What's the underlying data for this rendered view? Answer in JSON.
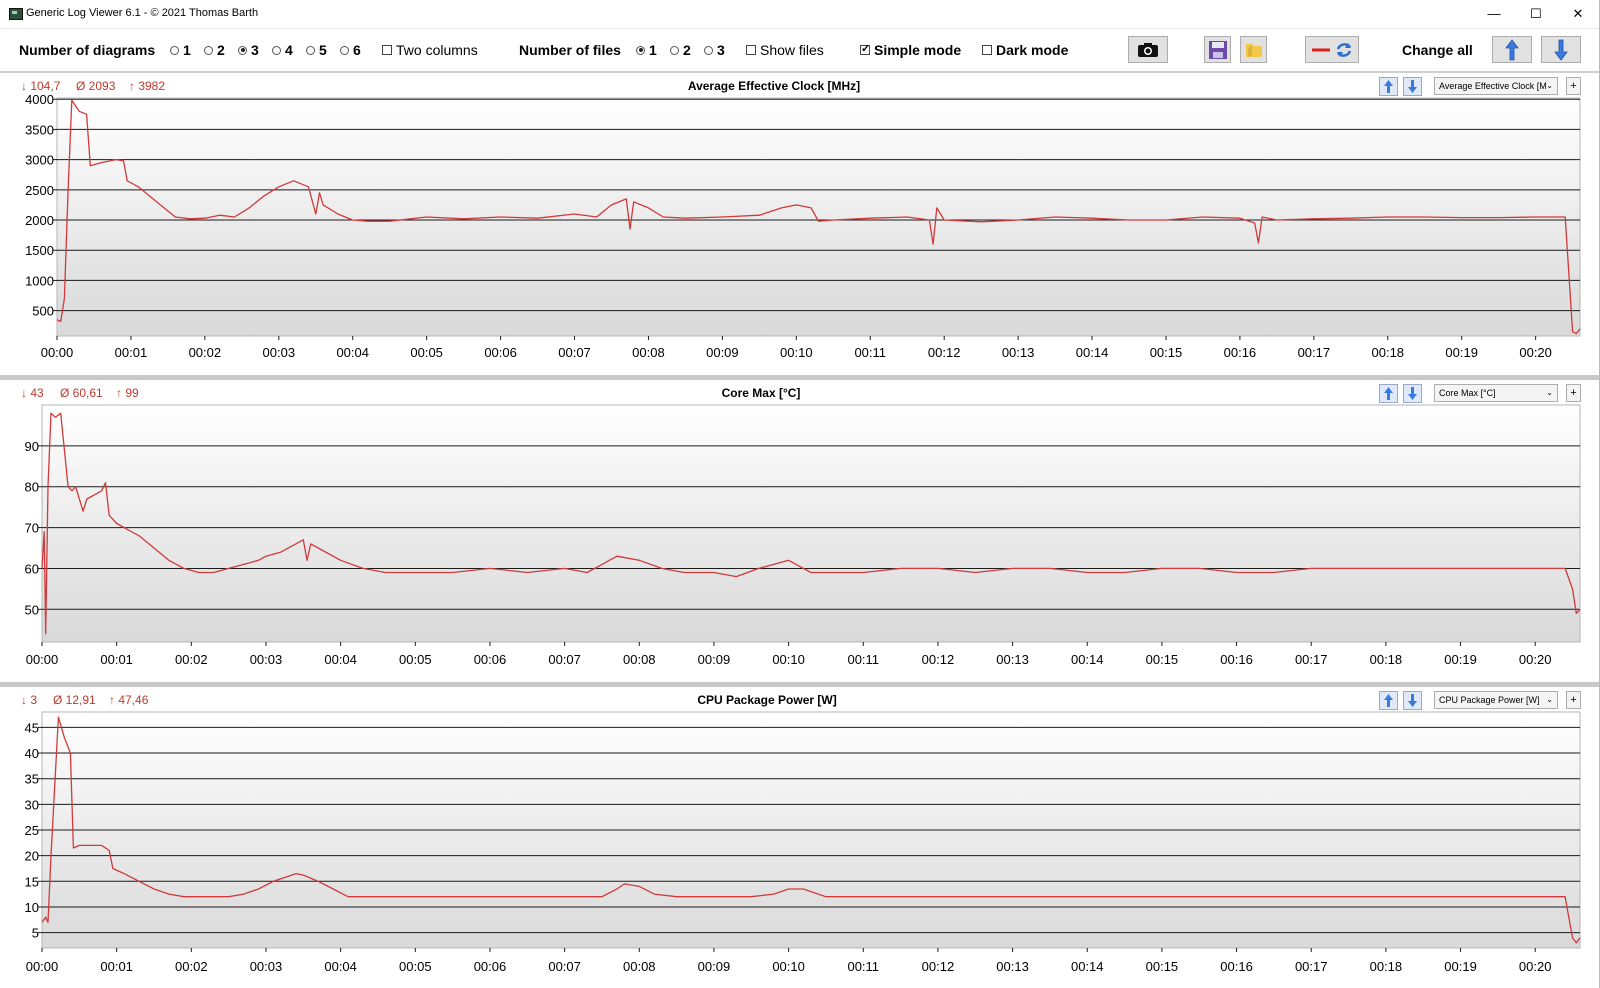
{
  "window": {
    "title": "Generic Log Viewer 6.1 - © 2021 Thomas Barth",
    "controls": {
      "minimize": "—",
      "maximize": "☐",
      "close": "✕"
    }
  },
  "toolbar": {
    "diagrams_label": "Number of diagrams",
    "diagram_options": [
      "1",
      "2",
      "3",
      "4",
      "5",
      "6"
    ],
    "diagrams_selected": "3",
    "two_columns_label": "Two columns",
    "files_label": "Number of files",
    "file_options": [
      "1",
      "2",
      "3"
    ],
    "files_selected": "1",
    "show_files_label": "Show files",
    "simple_mode_label": "Simple mode",
    "simple_mode_checked": true,
    "dark_mode_label": "Dark mode",
    "change_all_label": "Change all",
    "icons": [
      "camera-icon",
      "save-icon",
      "folder-icon",
      "line-refresh-icon",
      "arrow-up-icon",
      "arrow-down-icon"
    ]
  },
  "panels": [
    {
      "title": "Average Effective Clock [MHz]",
      "stat_min": "↓ 104,7",
      "stat_avg": "Ø  2093",
      "stat_max": "↑ 3982",
      "selector_label": "Average Effective Clock [M",
      "plus_label": "+"
    },
    {
      "title": "Core Max [°C]",
      "stat_min": "↓ 43",
      "stat_avg": "Ø  60,61",
      "stat_max": "↑ 99",
      "selector_label": "Core Max [°C]",
      "plus_label": "+"
    },
    {
      "title": "CPU Package Power [W]",
      "stat_min": "↓ 3",
      "stat_avg": "Ø  12,91",
      "stat_max": "↑ 47,46",
      "selector_label": "CPU Package Power [W]",
      "plus_label": "+"
    }
  ],
  "chart_data": [
    {
      "type": "line",
      "title": "Average Effective Clock [MHz]",
      "line_color": "#d03a3a",
      "x_unit": "minutes",
      "xlim": [
        0,
        20.6
      ],
      "ylim": [
        80,
        4020
      ],
      "x_ticks": [
        "00:00",
        "00:01",
        "00:02",
        "00:03",
        "00:04",
        "00:05",
        "00:06",
        "00:07",
        "00:08",
        "00:09",
        "00:10",
        "00:11",
        "00:12",
        "00:13",
        "00:14",
        "00:15",
        "00:16",
        "00:17",
        "00:18",
        "00:19",
        "00:20"
      ],
      "y_ticks": [
        500,
        1000,
        1500,
        2000,
        2500,
        3000,
        3500,
        4000
      ],
      "grid": true,
      "series": [
        {
          "x": [
            0,
            0.05,
            0.1,
            0.15,
            0.2,
            0.3,
            0.4,
            0.45,
            0.6,
            0.8,
            0.9,
            0.95,
            1.1,
            1.3,
            1.5,
            1.6,
            1.8,
            2.0,
            2.2,
            2.4,
            2.6,
            2.8,
            3.0,
            3.2,
            3.4,
            3.5,
            3.55,
            3.6,
            3.8,
            4.0,
            4.2,
            4.5,
            5.0,
            5.5,
            6.0,
            6.5,
            7.0,
            7.3,
            7.5,
            7.7,
            7.75,
            7.8,
            8.0,
            8.2,
            8.5,
            9.0,
            9.5,
            9.8,
            10.0,
            10.2,
            10.3,
            10.5,
            11.0,
            11.5,
            11.8,
            11.85,
            11.9,
            12.0,
            12.5,
            13.0,
            13.5,
            14.0,
            14.5,
            15.0,
            15.5,
            16.0,
            16.2,
            16.25,
            16.3,
            16.5,
            17.0,
            17.5,
            18.0,
            18.5,
            19.0,
            19.5,
            20.0,
            20.4,
            20.5,
            20.55,
            20.6
          ],
          "y": [
            350,
            320,
            700,
            2500,
            3980,
            3800,
            3750,
            2900,
            2950,
            3000,
            2980,
            2650,
            2550,
            2350,
            2150,
            2050,
            2020,
            2030,
            2080,
            2050,
            2200,
            2400,
            2550,
            2650,
            2550,
            2100,
            2450,
            2250,
            2100,
            2000,
            1980,
            1980,
            2050,
            2020,
            2050,
            2030,
            2100,
            2050,
            2250,
            2350,
            1850,
            2300,
            2200,
            2050,
            2030,
            2050,
            2080,
            2200,
            2250,
            2200,
            1980,
            2000,
            2030,
            2050,
            2000,
            1600,
            2200,
            2000,
            1970,
            2000,
            2050,
            2030,
            2000,
            2000,
            2050,
            2030,
            1950,
            1620,
            2050,
            2000,
            2020,
            2030,
            2050,
            2050,
            2040,
            2040,
            2050,
            2050,
            150,
            120,
            200
          ]
        }
      ]
    },
    {
      "type": "line",
      "title": "Core Max [°C]",
      "line_color": "#d03a3a",
      "x_unit": "minutes",
      "xlim": [
        0,
        20.6
      ],
      "ylim": [
        42,
        100
      ],
      "x_ticks": [
        "00:00",
        "00:01",
        "00:02",
        "00:03",
        "00:04",
        "00:05",
        "00:06",
        "00:07",
        "00:08",
        "00:09",
        "00:10",
        "00:11",
        "00:12",
        "00:13",
        "00:14",
        "00:15",
        "00:16",
        "00:17",
        "00:18",
        "00:19",
        "00:20"
      ],
      "y_ticks": [
        50,
        60,
        70,
        80,
        90
      ],
      "grid": true,
      "series": [
        {
          "x": [
            0,
            0.03,
            0.05,
            0.08,
            0.12,
            0.18,
            0.25,
            0.35,
            0.4,
            0.45,
            0.55,
            0.6,
            0.7,
            0.8,
            0.85,
            0.9,
            1.0,
            1.1,
            1.3,
            1.5,
            1.7,
            1.9,
            2.1,
            2.3,
            2.5,
            2.7,
            2.9,
            3.0,
            3.2,
            3.4,
            3.5,
            3.55,
            3.6,
            3.7,
            4.0,
            4.3,
            4.6,
            5.0,
            5.5,
            6.0,
            6.5,
            7.0,
            7.3,
            7.5,
            7.7,
            8.0,
            8.3,
            8.6,
            9.0,
            9.3,
            9.6,
            9.8,
            10.0,
            10.2,
            10.3,
            10.6,
            11.0,
            11.5,
            12.0,
            12.5,
            13.0,
            13.5,
            14.0,
            14.5,
            15.0,
            15.5,
            16.0,
            16.5,
            17.0,
            17.5,
            18.0,
            18.5,
            19.0,
            19.5,
            20.0,
            20.4,
            20.5,
            20.55,
            20.6
          ],
          "y": [
            60,
            69,
            44,
            80,
            98,
            97,
            98,
            80,
            79,
            80,
            74,
            77,
            78,
            79,
            81,
            73,
            71,
            70,
            68,
            65,
            62,
            60,
            59,
            59,
            60,
            61,
            62,
            63,
            64,
            66,
            67,
            62,
            66,
            65,
            62,
            60,
            59,
            59,
            59,
            60,
            59,
            60,
            59,
            61,
            63,
            62,
            60,
            59,
            59,
            58,
            60,
            61,
            62,
            60,
            59,
            59,
            59,
            60,
            60,
            59,
            60,
            60,
            59,
            59,
            60,
            60,
            59,
            59,
            60,
            60,
            60,
            60,
            60,
            60,
            60,
            60,
            55,
            49,
            50
          ]
        }
      ]
    },
    {
      "type": "line",
      "title": "CPU Package Power [W]",
      "line_color": "#d03a3a",
      "x_unit": "minutes",
      "xlim": [
        0,
        20.6
      ],
      "ylim": [
        2,
        48
      ],
      "x_ticks": [
        "00:00",
        "00:01",
        "00:02",
        "00:03",
        "00:04",
        "00:05",
        "00:06",
        "00:07",
        "00:08",
        "00:09",
        "00:10",
        "00:11",
        "00:12",
        "00:13",
        "00:14",
        "00:15",
        "00:16",
        "00:17",
        "00:18",
        "00:19",
        "00:20"
      ],
      "y_ticks": [
        5,
        10,
        15,
        20,
        25,
        30,
        35,
        40,
        45
      ],
      "grid": true,
      "series": [
        {
          "x": [
            0,
            0.05,
            0.08,
            0.12,
            0.22,
            0.3,
            0.38,
            0.42,
            0.5,
            0.6,
            0.7,
            0.8,
            0.9,
            0.95,
            1.1,
            1.3,
            1.5,
            1.7,
            1.9,
            2.1,
            2.3,
            2.5,
            2.7,
            2.9,
            3.1,
            3.3,
            3.4,
            3.5,
            3.7,
            3.9,
            4.1,
            4.5,
            5.0,
            5.5,
            6.0,
            6.5,
            7.0,
            7.3,
            7.5,
            7.7,
            7.8,
            8.0,
            8.2,
            8.5,
            9.0,
            9.5,
            9.8,
            10.0,
            10.2,
            10.3,
            10.5,
            11.0,
            12.0,
            13.0,
            14.0,
            15.0,
            16.0,
            17.0,
            18.0,
            19.0,
            20.0,
            20.4,
            20.5,
            20.55,
            20.6
          ],
          "y": [
            7,
            8,
            7,
            20,
            47,
            43,
            40,
            21.5,
            22,
            22,
            22,
            22,
            21,
            17.5,
            16.5,
            15,
            13.5,
            12.5,
            12,
            12,
            12,
            12,
            12.5,
            13.5,
            15,
            16,
            16.5,
            16.2,
            15,
            13.5,
            12,
            12,
            12,
            12,
            12,
            12,
            12,
            12,
            12,
            13.5,
            14.5,
            14,
            12.5,
            12,
            12,
            12,
            12.5,
            13.5,
            13.5,
            13,
            12,
            12,
            12,
            12,
            12,
            12,
            12,
            12,
            12,
            12,
            12,
            12,
            4,
            3,
            4
          ]
        }
      ]
    }
  ]
}
